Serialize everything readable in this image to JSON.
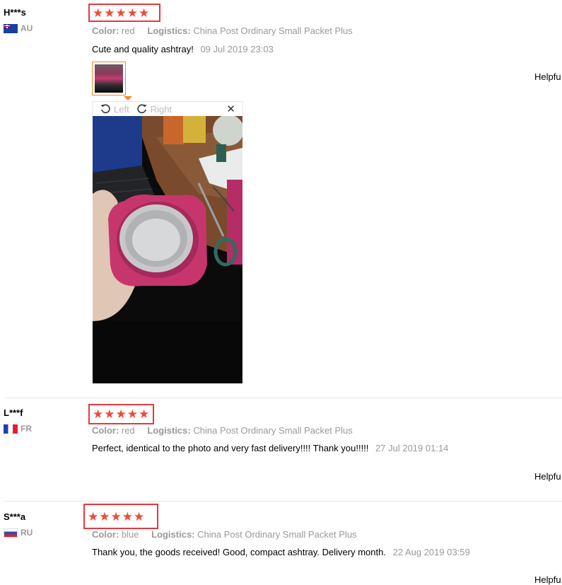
{
  "reviews": [
    {
      "user": "H***s",
      "country": "AU",
      "flag_icon": "australia-flag-icon",
      "rating": 5,
      "color_label": "Color:",
      "color_value": "red",
      "logistics_label": "Logistics:",
      "logistics_value": "China Post Ordinary Small Packet Plus",
      "text": "Cute and quality ashtray!",
      "date": "09 Jul 2019 23:03",
      "helpful": "Helpfu"
    },
    {
      "user": "L***f",
      "country": "FR",
      "flag_icon": "france-flag-icon",
      "rating": 5,
      "color_label": "Color:",
      "color_value": "red",
      "logistics_label": "Logistics:",
      "logistics_value": "China Post Ordinary Small Packet Plus",
      "text": "Perfect, identical to the photo and very fast delivery!!!! Thank you!!!!!",
      "date": "27 Jul 2019 01:14",
      "helpful": "Helpfu"
    },
    {
      "user": "S***a",
      "country": "RU",
      "flag_icon": "russia-flag-icon",
      "rating": 5,
      "color_label": "Color:",
      "color_value": "blue",
      "logistics_label": "Logistics:",
      "logistics_value": "China Post Ordinary Small Packet Plus",
      "text": "Thank you, the goods received! Good, compact ashtray. Delivery month.",
      "date": "22 Aug 2019 03:59",
      "helpful": "Helpfu"
    }
  ],
  "viewer": {
    "rotate_left_label": "Left",
    "rotate_right_label": "Right",
    "close_icon": "close-icon",
    "rotate_left_icon": "rotate-left-icon",
    "rotate_right_icon": "rotate-right-icon"
  },
  "colors": {
    "star": "#f04a36",
    "highlight_border": "#e03a40",
    "thumb_border": "#f08a24",
    "muted_text": "#999999"
  }
}
